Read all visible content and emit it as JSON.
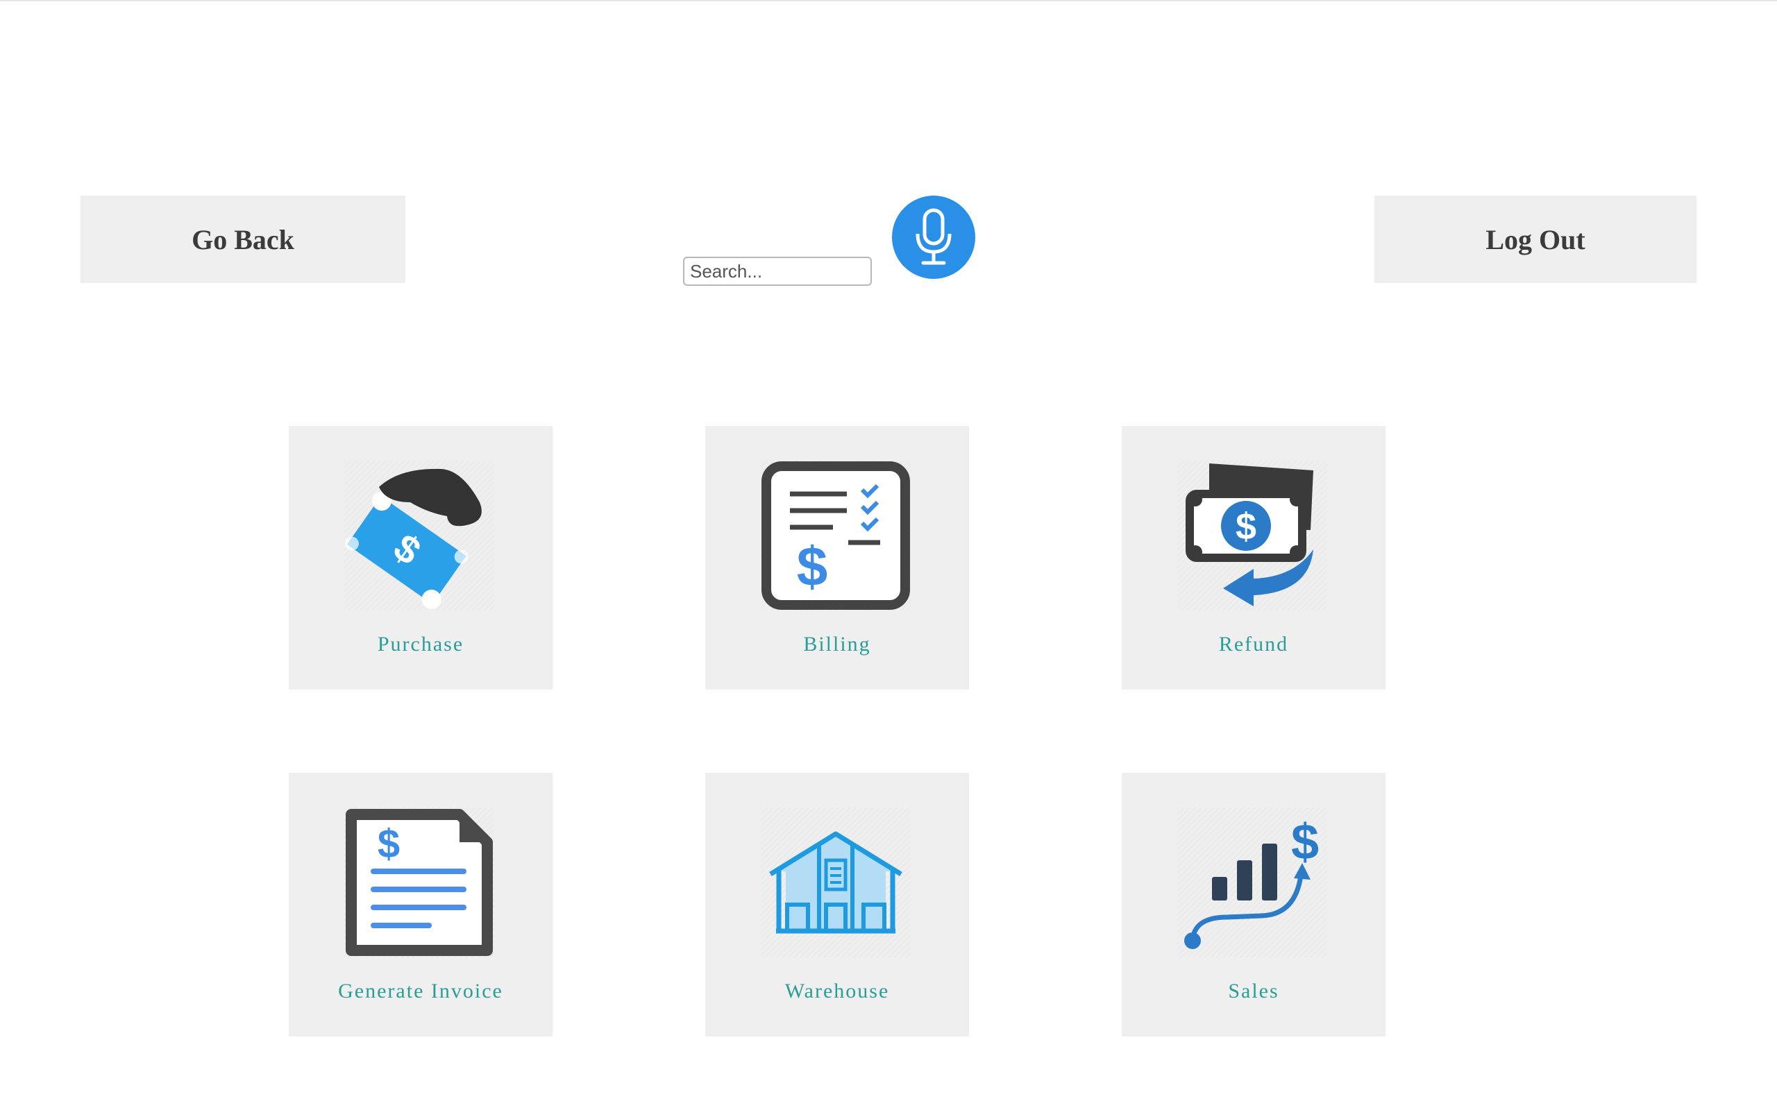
{
  "header": {
    "go_back_label": "Go Back",
    "log_out_label": "Log Out"
  },
  "search": {
    "placeholder": "Search...",
    "value": ""
  },
  "mic": {
    "icon": "microphone-icon",
    "color": "#2a8fe6"
  },
  "tiles": [
    {
      "label": "Purchase",
      "icon": "cash-hand-icon"
    },
    {
      "label": "Billing",
      "icon": "bill-checklist-icon"
    },
    {
      "label": "Refund",
      "icon": "money-refund-icon"
    },
    {
      "label": "Generate Invoice",
      "icon": "invoice-document-icon"
    },
    {
      "label": "Warehouse",
      "icon": "warehouse-icon"
    },
    {
      "label": "Sales",
      "icon": "sales-growth-icon"
    }
  ],
  "colors": {
    "tile_background": "#efefef",
    "label_text": "#2a9d97",
    "accent_blue": "#2a8fe6",
    "icon_dark": "#3a3a3a"
  }
}
